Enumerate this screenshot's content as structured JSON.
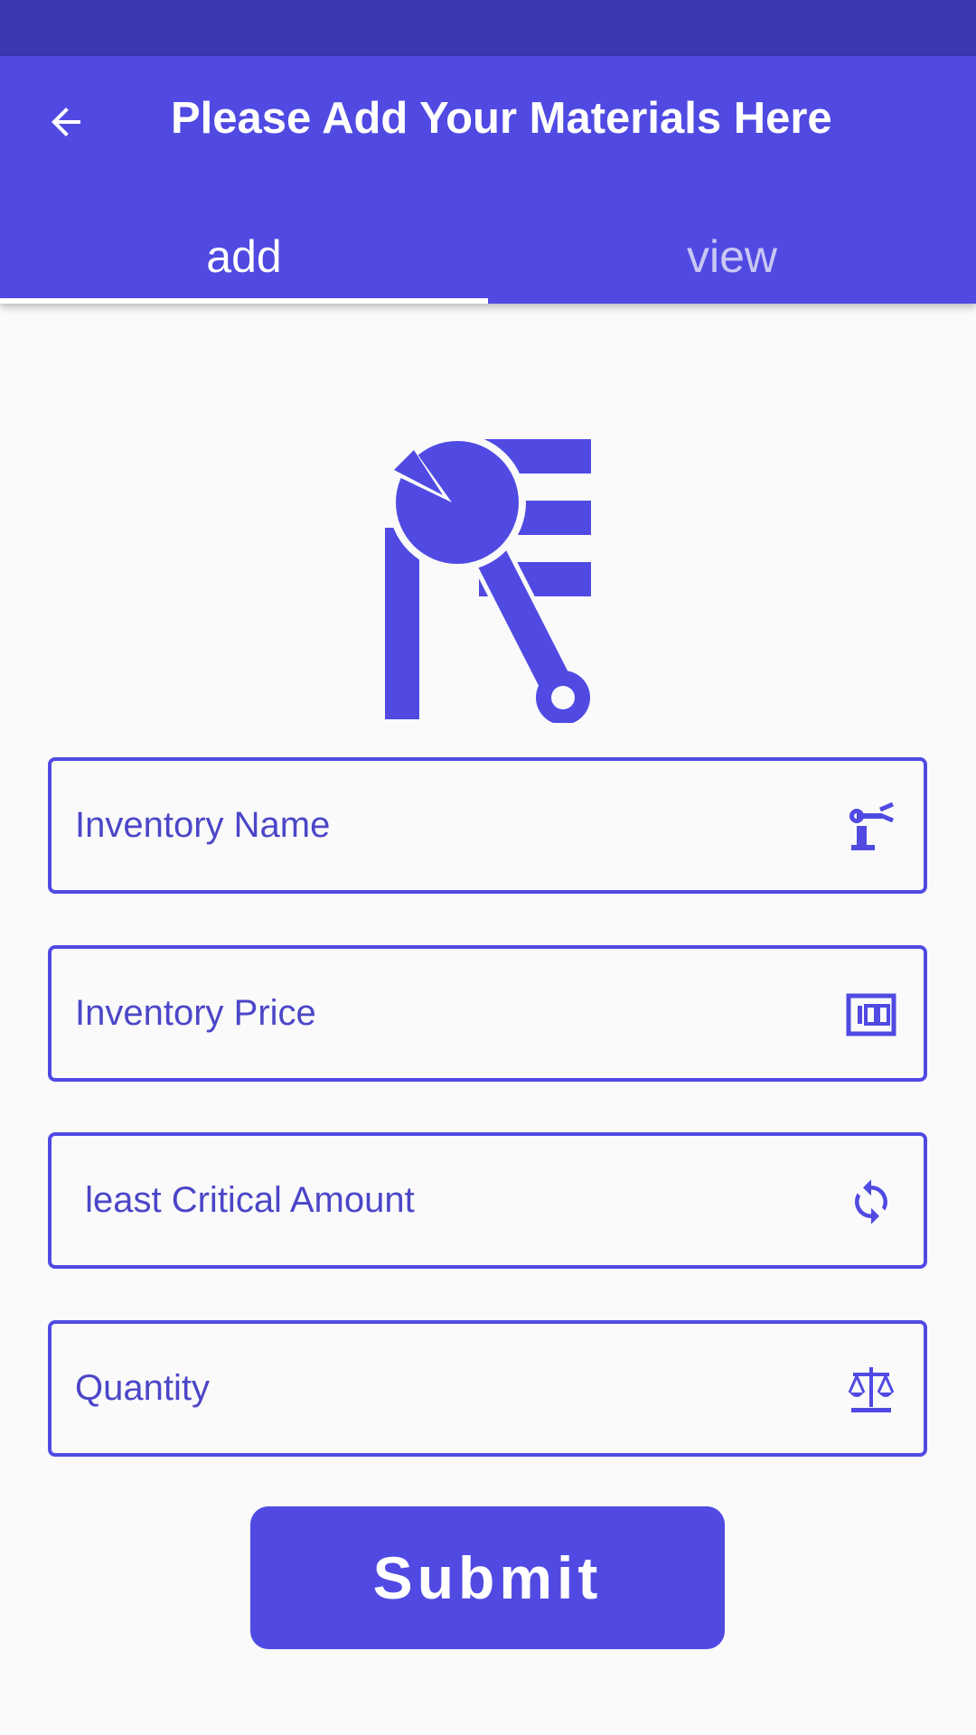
{
  "colors": {
    "primary": "#504ae3",
    "status_bar": "#3b38b0",
    "background": "#fafafa",
    "tab_inactive_text": "#c9c7f4"
  },
  "header": {
    "title": "Please Add Your Materials Here",
    "back_icon": "arrow-left-icon"
  },
  "tabs": [
    {
      "label": "add",
      "selected": true
    },
    {
      "label": "view",
      "selected": false
    }
  ],
  "logo": {
    "icon": "wrench-logo-icon"
  },
  "form": {
    "fields": [
      {
        "placeholder": "Inventory Name",
        "value": "",
        "icon": "robot-arm-icon"
      },
      {
        "placeholder": "Inventory Price",
        "value": "",
        "icon": "money-100-icon"
      },
      {
        "placeholder": " least Critical Amount",
        "value": "",
        "icon": "refresh-icon"
      },
      {
        "placeholder": "Quantity",
        "value": "",
        "icon": "scale-icon"
      }
    ],
    "submit_label": "Submit"
  }
}
